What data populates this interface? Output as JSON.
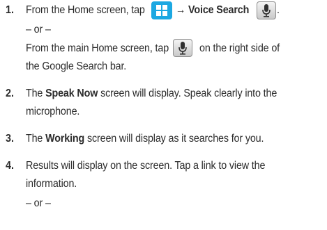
{
  "steps": [
    {
      "number": "1.",
      "line1_a": "From the Home screen, tap",
      "arrow": "→",
      "line1_bold": "Voice Search",
      "line1_end": ".",
      "or1": "– or –",
      "line2_a": "From the main Home screen, tap",
      "line2_b": "on the right side of",
      "line3": "the Google Search bar."
    },
    {
      "number": "2.",
      "text_a": "The",
      "bold": "Speak Now",
      "text_b": "screen will display. Speak clearly into the",
      "line2": "microphone."
    },
    {
      "number": "3.",
      "text_a": "The",
      "bold": "Working",
      "text_b": "screen will display as it searches for you."
    },
    {
      "number": "4.",
      "line1": "Results will display on the screen. Tap a link to view the",
      "line2": "information.",
      "or": "– or –"
    }
  ],
  "icons": {
    "apps": "apps-grid-icon",
    "mic": "microphone-icon"
  },
  "colors": {
    "apps_icon": "#1ca8e2",
    "text": "#2b2b2b"
  }
}
